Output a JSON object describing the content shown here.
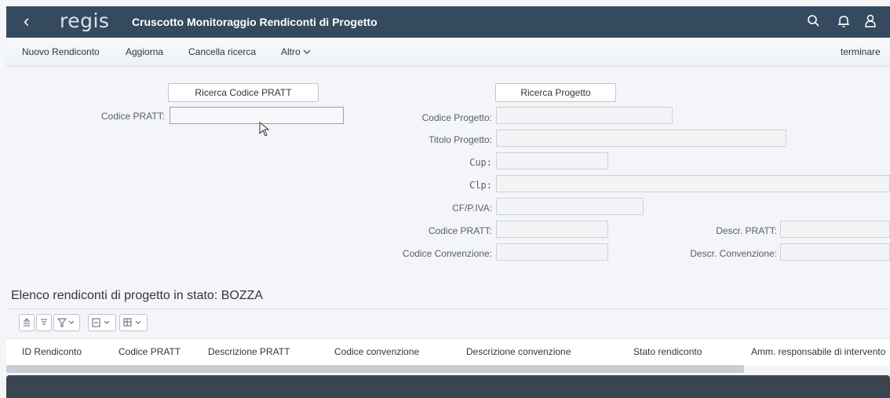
{
  "header": {
    "back_icon": "‹",
    "logo": "regis",
    "title": "Cruscotto Monitoraggio Rendiconti di Progetto"
  },
  "toolbar": {
    "nuovo": "Nuovo Rendiconto",
    "aggiorna": "Aggiorna",
    "cancella": "Cancella ricerca",
    "altro": "Altro",
    "terminare": "terminare"
  },
  "left_form": {
    "ricerca_button": "Ricerca Codice PRATT",
    "codice_pratt_label": "Codice PRATT:"
  },
  "right_form": {
    "ricerca_button": "Ricerca Progetto",
    "codice_progetto_label": "Codice Progetto:",
    "titolo_progetto_label": "Titolo Progetto:",
    "cup_label": "Cup:",
    "clp_label": "Clp:",
    "cf_label": "CF/P.IVA:",
    "codice_pratt_label": "Codice PRATT:",
    "descr_pratt_label": "Descr. PRATT:",
    "codice_convenzione_label": "Codice Convenzione:",
    "descr_convenzione_label": "Descr. Convenzione:"
  },
  "table": {
    "title": "Elenco rendiconti di progetto in stato: BOZZA",
    "columns": [
      "ID Rendiconto",
      "Codice PRATT",
      "Descrizione PRATT",
      "Codice convenzione",
      "Descrizione convenzione",
      "Stato rendiconto",
      "Amm. responsabile di intervento"
    ]
  },
  "colors": {
    "shell": "#354a5f",
    "footer": "#3b454f"
  }
}
